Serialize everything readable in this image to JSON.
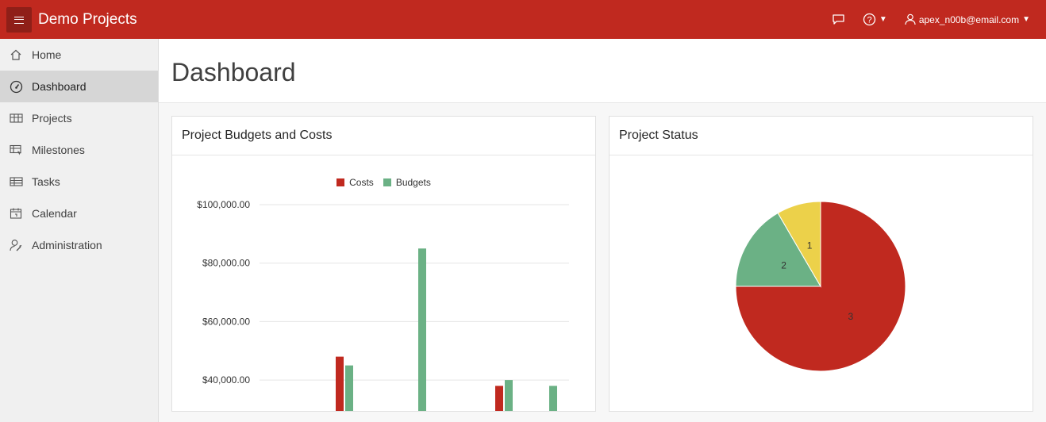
{
  "header": {
    "app_title": "Demo Projects",
    "menu_icon": "hamburger-icon",
    "feedback_icon": "chat-bubble-icon",
    "help_icon": "question-circle-icon",
    "user_icon": "user-icon",
    "user_email": "apex_n00b@email.com",
    "brand_color": "#c0291f"
  },
  "sidebar": {
    "items": [
      {
        "label": "Home",
        "icon": "home-icon"
      },
      {
        "label": "Dashboard",
        "icon": "gauge-icon",
        "active": true
      },
      {
        "label": "Projects",
        "icon": "table-icon"
      },
      {
        "label": "Milestones",
        "icon": "list-cursor-icon"
      },
      {
        "label": "Tasks",
        "icon": "grid-icon"
      },
      {
        "label": "Calendar",
        "icon": "calendar-icon"
      },
      {
        "label": "Administration",
        "icon": "user-wrench-icon"
      }
    ]
  },
  "main": {
    "page_title": "Dashboard",
    "regions": [
      {
        "title": "Project Budgets and Costs"
      },
      {
        "title": "Project Status"
      }
    ]
  },
  "chart_data": [
    {
      "type": "bar",
      "title": "Project Budgets and Costs",
      "legend_position": "top-center",
      "series": [
        {
          "name": "Costs",
          "color": "#c0291f",
          "values": [
            48000,
            null,
            38000,
            null
          ]
        },
        {
          "name": "Budgets",
          "color": "#6bb185",
          "values": [
            45000,
            85000,
            40000,
            38000
          ]
        }
      ],
      "y_ticks": [
        "$100,000.00",
        "$80,000.00",
        "$60,000.00",
        "$40,000.00"
      ],
      "y_tick_values": [
        100000,
        80000,
        60000,
        40000
      ],
      "ylim": [
        30000,
        100000
      ],
      "grid": true
    },
    {
      "type": "pie",
      "title": "Project Status",
      "slices": [
        {
          "label": "3",
          "value": 3,
          "color": "#c0291f",
          "fraction": 0.75
        },
        {
          "label": "2",
          "value": 2,
          "color": "#6bb185",
          "fraction": 0.166
        },
        {
          "label": "1",
          "value": 1,
          "color": "#ecd14a",
          "fraction": 0.084
        }
      ]
    }
  ]
}
